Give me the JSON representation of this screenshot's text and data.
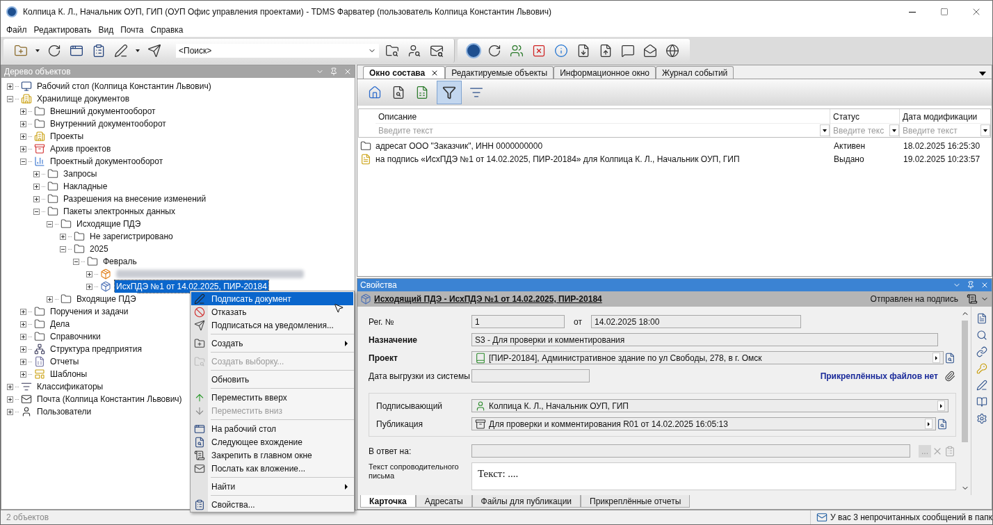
{
  "window": {
    "title": "Колпица К. Л., Начальник ОУП, ГИП (ОУП Офис управления проектами) - TDMS Фарватер (пользователь Колпица Константин Львович)"
  },
  "menu": [
    "Файл",
    "Редактировать",
    "Вид",
    "Почта",
    "Справка"
  ],
  "toolbar": {
    "search": {
      "value": "<Поиск>"
    }
  },
  "tree_panel": {
    "title": "Дерево объектов",
    "nodes": [
      {
        "kind": "desktop",
        "label": "Рабочий стол (Колпица Константин Львович)",
        "expanded": false,
        "selected": false
      },
      {
        "kind": "storage",
        "label": "Хранилище документов",
        "expanded": true,
        "selected": false,
        "children": [
          {
            "kind": "folder",
            "label": "Внешний документооборот",
            "expanded": false,
            "selected": false
          },
          {
            "kind": "folder",
            "label": "Внутренний документооборот",
            "expanded": false,
            "selected": false
          },
          {
            "kind": "storage",
            "label": "Проекты",
            "expanded": false,
            "selected": false
          },
          {
            "kind": "archive",
            "label": "Архив проектов",
            "expanded": false,
            "selected": false
          },
          {
            "kind": "docflow",
            "label": "Проектный документооборот",
            "expanded": true,
            "selected": false,
            "children": [
              {
                "kind": "folder",
                "label": "Запросы",
                "expanded": false,
                "selected": false
              },
              {
                "kind": "folder",
                "label": "Накладные",
                "expanded": false,
                "selected": false
              },
              {
                "kind": "folder",
                "label": "Разрешения на внесение изменений",
                "expanded": false,
                "selected": false
              },
              {
                "kind": "folder",
                "label": "Пакеты электронных данных",
                "expanded": true,
                "selected": false,
                "children": [
                  {
                    "kind": "folder",
                    "label": "Исходящие ПДЭ",
                    "expanded": true,
                    "selected": false,
                    "children": [
                      {
                        "kind": "folder",
                        "label": "Не зарегистрировано",
                        "expanded": false,
                        "selected": false
                      },
                      {
                        "kind": "folder",
                        "label": "2025",
                        "expanded": true,
                        "selected": false,
                        "children": [
                          {
                            "kind": "folder",
                            "label": "Февраль",
                            "expanded": true,
                            "selected": false,
                            "children": [
                              {
                                "kind": "package",
                                "blurred": true,
                                "expanded": false,
                                "selected": false
                              },
                              {
                                "kind": "package-signing",
                                "label": "ИсхПДЭ №1 от 14.02.2025, ПИР-20184",
                                "expanded": false,
                                "selected": true
                              }
                            ]
                          }
                        ]
                      }
                    ]
                  },
                  {
                    "kind": "folder",
                    "label": "Входящие ПДЭ",
                    "expanded": false,
                    "selected": false
                  }
                ]
              }
            ]
          },
          {
            "kind": "folder",
            "label": "Поручения и задачи",
            "expanded": false,
            "selected": false
          },
          {
            "kind": "folder",
            "label": "Дела",
            "expanded": false,
            "selected": false
          },
          {
            "kind": "folder",
            "label": "Справочники",
            "expanded": false,
            "selected": false
          },
          {
            "kind": "structure",
            "label": "Структура предприятия",
            "expanded": false,
            "selected": false
          },
          {
            "kind": "reports",
            "label": "Отчеты",
            "expanded": false,
            "selected": false
          },
          {
            "kind": "templates",
            "label": "Шаблоны",
            "expanded": false,
            "selected": false
          }
        ]
      },
      {
        "kind": "classifier",
        "label": "Классификаторы",
        "expanded": false,
        "selected": false
      },
      {
        "kind": "mail",
        "label": "Почта (Колпица Константин Львович)",
        "expanded": false,
        "selected": false
      },
      {
        "kind": "users",
        "label": "Пользователи",
        "expanded": false,
        "selected": false
      }
    ]
  },
  "context_menu": [
    {
      "kind": "sign",
      "label": "Подписать документ",
      "selected": true,
      "disabled": false,
      "submenu": false,
      "separator_before": false
    },
    {
      "kind": "refuse",
      "label": "Отказать",
      "selected": false,
      "disabled": false,
      "submenu": false,
      "separator_before": false
    },
    {
      "kind": "subscribe",
      "label": "Подписаться на уведомления...",
      "selected": false,
      "disabled": false,
      "submenu": false,
      "separator_before": false
    },
    {
      "kind": "create",
      "label": "Создать",
      "selected": false,
      "disabled": false,
      "submenu": true,
      "separator_before": true
    },
    {
      "kind": "query",
      "label": "Создать выборку...",
      "selected": false,
      "disabled": true,
      "submenu": false,
      "separator_before": true
    },
    {
      "kind": "plain",
      "label": "Обновить",
      "selected": false,
      "disabled": false,
      "submenu": false,
      "separator_before": true
    },
    {
      "kind": "up",
      "label": "Переместить вверх",
      "selected": false,
      "disabled": false,
      "submenu": false,
      "separator_before": true
    },
    {
      "kind": "down",
      "label": "Переместить вниз",
      "selected": false,
      "disabled": true,
      "submenu": false,
      "separator_before": false
    },
    {
      "kind": "desktop",
      "label": "На рабочий стол",
      "selected": false,
      "disabled": false,
      "submenu": false,
      "separator_before": true
    },
    {
      "kind": "next",
      "label": "Следующее вхождение",
      "selected": false,
      "disabled": false,
      "submenu": false,
      "separator_before": false
    },
    {
      "kind": "pin",
      "label": "Закрепить в главном окне",
      "selected": false,
      "disabled": false,
      "submenu": false,
      "separator_before": false
    },
    {
      "kind": "attach",
      "label": "Послать как вложение...",
      "selected": false,
      "disabled": false,
      "submenu": false,
      "separator_before": false
    },
    {
      "kind": "plain",
      "label": "Найти",
      "selected": false,
      "disabled": false,
      "submenu": true,
      "separator_before": true
    },
    {
      "kind": "properties",
      "label": "Свойства...",
      "selected": false,
      "disabled": false,
      "submenu": false,
      "separator_before": true
    }
  ],
  "tabs": [
    {
      "label": "Окно состава",
      "selected": true
    },
    {
      "label": "Редактируемые объекты",
      "selected": false
    },
    {
      "label": "Информационное окно",
      "selected": false
    },
    {
      "label": "Журнал событий",
      "selected": false
    }
  ],
  "table": {
    "columns": [
      {
        "label": "Описание",
        "placeholder": "Введите текст"
      },
      {
        "label": "Статус",
        "placeholder": "Введите текс"
      },
      {
        "label": "Дата модификации",
        "placeholder": "Введите текст"
      }
    ],
    "rows": [
      {
        "kind": "folder",
        "cells": [
          "адресат ООО \"Заказчик\", ИНН 0000000000",
          "Активен",
          "18.02.2025 16:25:30"
        ]
      },
      {
        "kind": "task",
        "cells": [
          "на подпись «ИсхПДЭ №1 от 14.02.2025, ПИР-20184» для Колпица К. Л., Начальник ОУП, ГИП",
          "Выдано",
          "19.02.2025 10:23:57"
        ]
      }
    ]
  },
  "properties": {
    "title": "Свойства",
    "header": "Исходящий ПДЭ - ИсхПДЭ №1 от 14.02.2025, ПИР-20184",
    "status": "Отправлен на подпись",
    "reg": {
      "label": "Рег. №",
      "value": "1",
      "date_label": "от",
      "date_value": "14.02.2025 18:00"
    },
    "purpose": {
      "label": "Назначение",
      "value": "S3 - Для проверки и комментирования"
    },
    "project": {
      "label": "Проект",
      "value": "[ПИР-20184], Административное здание по ул Свободы, 278, в г. Омск"
    },
    "export_date": {
      "label": "Дата выгрузки из системы"
    },
    "attachments_note": "Прикреплённых файлов нет",
    "signer": {
      "label": "Подписывающий",
      "value": "Колпица К. Л., Начальник ОУП, ГИП"
    },
    "publication": {
      "label": "Публикация",
      "value": "Для проверки и комментирования R01 от 14.02.2025 16:05:13"
    },
    "reply_to": {
      "label": "В ответ на:",
      "button": "..."
    },
    "cover_letter": {
      "label": "Текст сопроводительного письма",
      "value": "Текст: ...."
    },
    "tabs": [
      {
        "label": "Карточка",
        "selected": true
      },
      {
        "label": "Адресаты",
        "selected": false
      },
      {
        "label": "Файлы для публикации",
        "selected": false
      },
      {
        "label": "Прикреплённые отчеты",
        "selected": false
      }
    ]
  },
  "status_bar": {
    "count": "2 объектов",
    "message": "У вас 3 непрочитанных сообщений в папк"
  }
}
